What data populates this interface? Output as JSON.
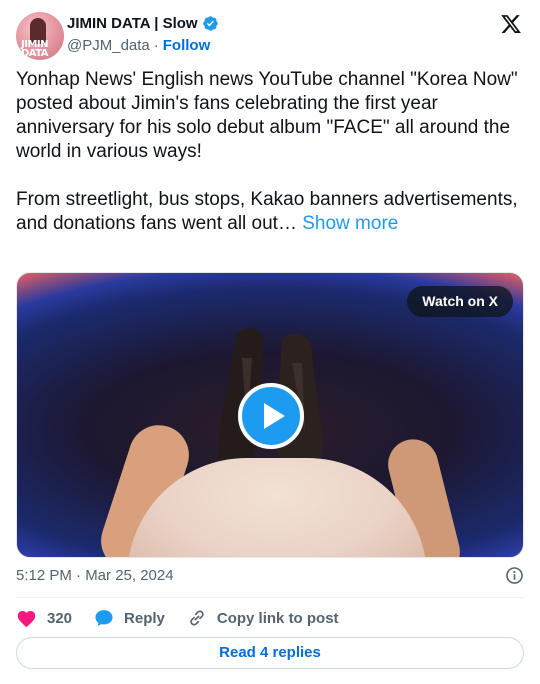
{
  "author": {
    "display_name": "JIMIN DATA | Slow",
    "handle": "@PJM_data",
    "separator": "·",
    "follow_label": "Follow",
    "avatar_text": "JIMIN\nDATA",
    "verified_icon": "verified-badge-icon",
    "verified_color": "#1d9bf0"
  },
  "platform_icon": "x-logo-icon",
  "tweet": {
    "paragraph_1": "Yonhap News' English news YouTube channel \"Korea Now\" posted about Jimin's fans celebrating the first year anniversary for his solo debut album \"FACE\" all around the world in various ways!",
    "paragraph_2": "From streetlight, bus stops, Kakao banners advertisements, and donations fans went all out… ",
    "show_more_label": "Show more"
  },
  "media": {
    "watch_label": "Watch on X",
    "play_icon": "play-icon",
    "play_color": "#1d9bf0"
  },
  "meta": {
    "timestamp": "5:12 PM · Mar 25, 2024",
    "info_icon": "info-icon"
  },
  "actions": {
    "like_count": "320",
    "like_icon": "heart-icon",
    "like_color": "#f91880",
    "reply_label": "Reply",
    "reply_icon": "speech-bubble-icon",
    "copy_label": "Copy link to post",
    "copy_icon": "link-icon"
  },
  "read_replies_label": "Read 4 replies",
  "colors": {
    "accent": "#1d9bf0",
    "link": "#006fd6",
    "muted": "#536471",
    "text": "#0f1419"
  }
}
